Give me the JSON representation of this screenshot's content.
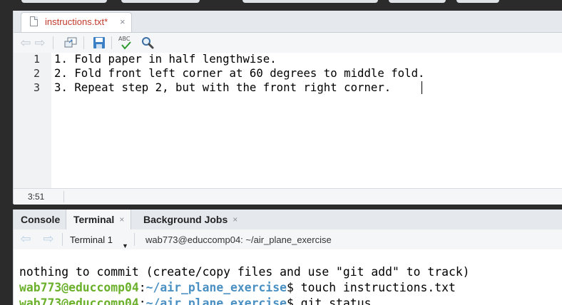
{
  "editor": {
    "tab": {
      "filename": "instructions.txt*",
      "close_glyph": "×"
    },
    "toolbar": {
      "back_icon": "back-arrow-icon",
      "forward_icon": "forward-arrow-icon",
      "show_in_window_icon": "show-in-new-window-icon",
      "save_icon": "save-icon",
      "spellcheck_text": "ABC",
      "spellcheck_icon": "spellcheck-icon",
      "search_icon": "search-icon"
    },
    "lines": [
      {
        "number": "1",
        "text": "1. Fold paper in half lengthwise."
      },
      {
        "number": "2",
        "text": "2. Fold front left corner at 60 degrees to middle fold."
      },
      {
        "number": "3",
        "text": "3. Repeat step 2, but with the front right corner."
      }
    ],
    "status": {
      "cursor_position": "3:51"
    }
  },
  "bottom": {
    "tabs": [
      {
        "label": "Console",
        "closable": false
      },
      {
        "label": "Terminal",
        "closable": true,
        "active": true
      },
      {
        "label": "Background Jobs",
        "closable": true
      }
    ],
    "close_glyph": "×",
    "terminal_toolbar": {
      "terminal_selector": "Terminal 1",
      "session_title": "wab773@educcomp04: ~/air_plane_exercise"
    },
    "terminal_lines": [
      {
        "plain": "nothing to commit (create/copy files and use \"git add\" to track)"
      },
      {
        "user": "wab773@educcomp04",
        "sep": ":",
        "path": "~/air_plane_exercise",
        "cmd": "$ touch instructions.txt"
      },
      {
        "user": "wab773@educcomp04",
        "sep": ":",
        "path": "~/air_plane_exercise",
        "cmd": "$ git status"
      }
    ]
  },
  "colors": {
    "modified_tab_text": "#c0392b",
    "prompt_user": "#6bb02b",
    "prompt_path": "#4a90c2",
    "save_icon": "#3b7fc4",
    "spellcheck_check": "#2e9a2e"
  }
}
